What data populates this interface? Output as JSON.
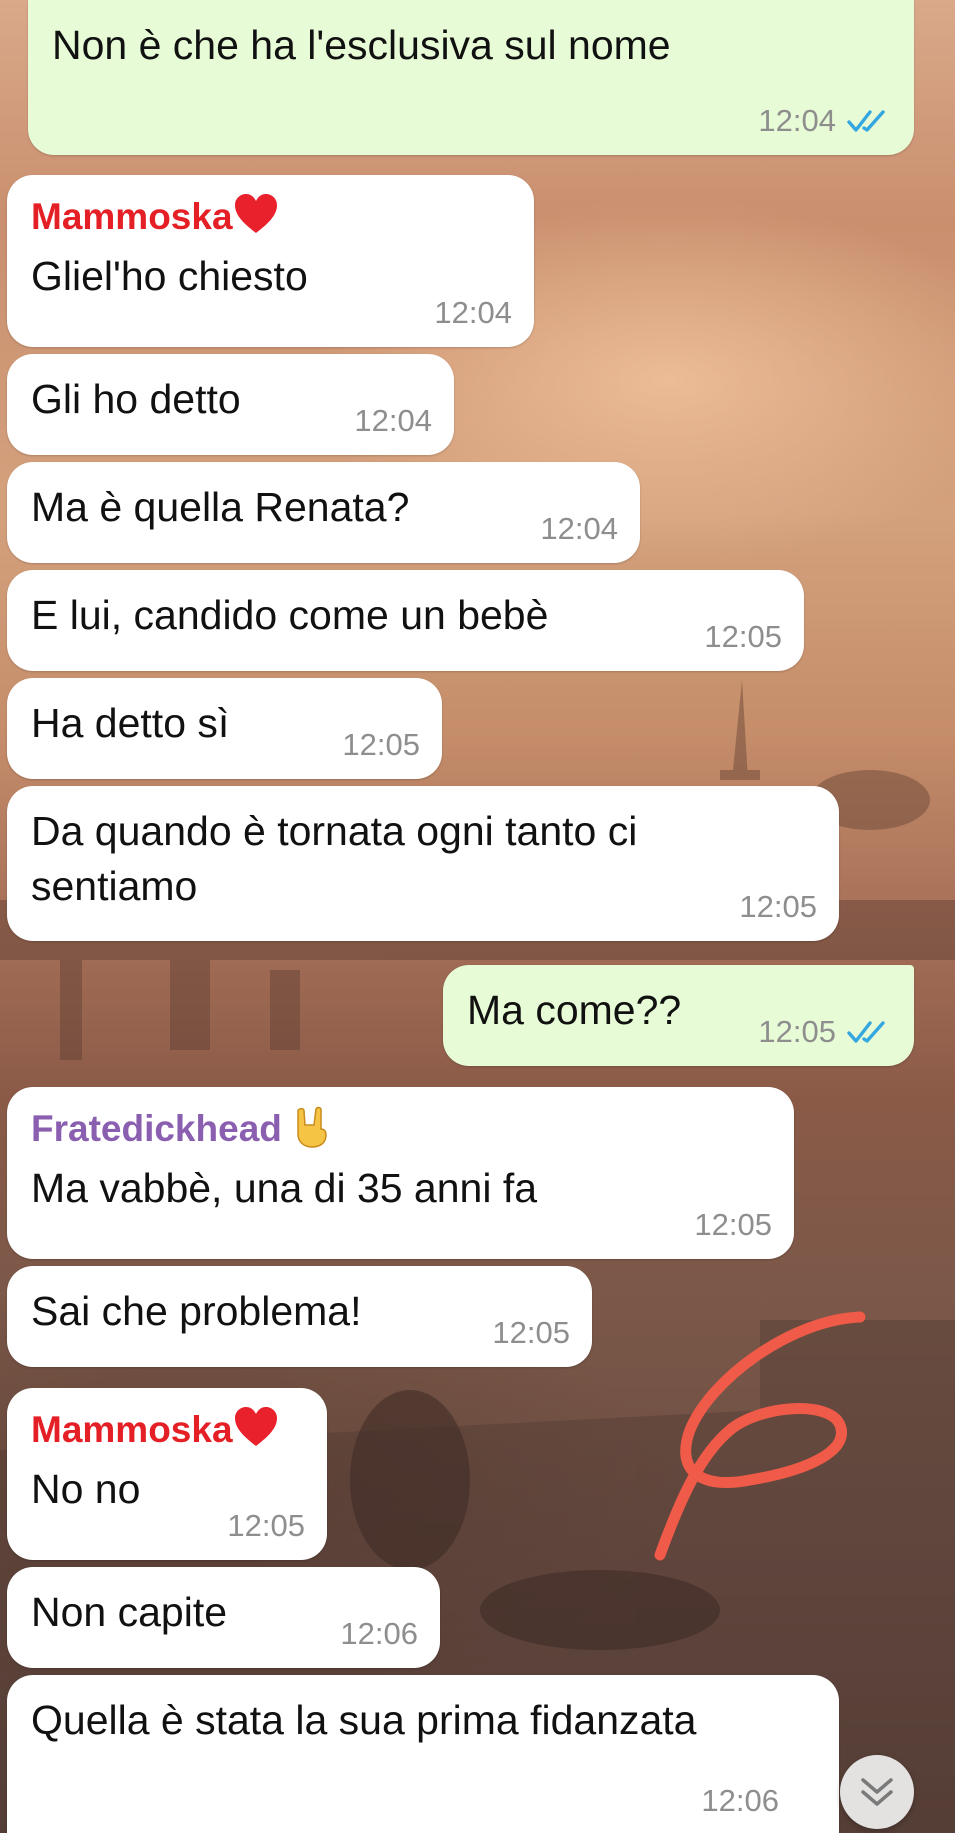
{
  "colors": {
    "outgoing_bubble": "#e7fcd6",
    "incoming_bubble": "#ffffff",
    "sender_mammoska": "#e41f25",
    "sender_fratedickhead": "#8b5fb0",
    "read_ticks": "#34a6e0",
    "annotation_scribble": "#ef5b48"
  },
  "icons": {
    "sender_mammoska_emoji": "red-heart",
    "sender_fratedickhead_emoji": "sign-of-the-horns",
    "read_receipt": "double-check",
    "scroll_down": "double-chevron-down"
  },
  "messages": [
    {
      "type": "out",
      "text": "Non è che ha l'esclusiva sul nome",
      "time": "12:04"
    },
    {
      "type": "in",
      "sender": "Mammoska",
      "text": "Gliel'ho chiesto",
      "time": "12:04"
    },
    {
      "type": "in",
      "text": "Gli ho detto",
      "time": "12:04"
    },
    {
      "type": "in",
      "text": "Ma è quella Renata?",
      "time": "12:04"
    },
    {
      "type": "in",
      "text": "E lui, candido come un bebè",
      "time": "12:05"
    },
    {
      "type": "in",
      "text": "Ha detto sì",
      "time": "12:05"
    },
    {
      "type": "in",
      "text": "Da quando è tornata ogni tanto ci\nsentiamo",
      "time": "12:05"
    },
    {
      "type": "out",
      "text": "Ma come??",
      "time": "12:05"
    },
    {
      "type": "in",
      "sender": "Fratedickhead",
      "text": "Ma vabbè, una di 35 anni fa",
      "time": "12:05"
    },
    {
      "type": "in",
      "text": "Sai che problema!",
      "time": "12:05"
    },
    {
      "type": "in",
      "sender": "Mammoska",
      "text": "No no",
      "time": "12:05"
    },
    {
      "type": "in",
      "text": "Non capite",
      "time": "12:06"
    },
    {
      "type": "in",
      "text": "Quella è stata la sua prima fidanzata",
      "time": "12:06"
    }
  ]
}
